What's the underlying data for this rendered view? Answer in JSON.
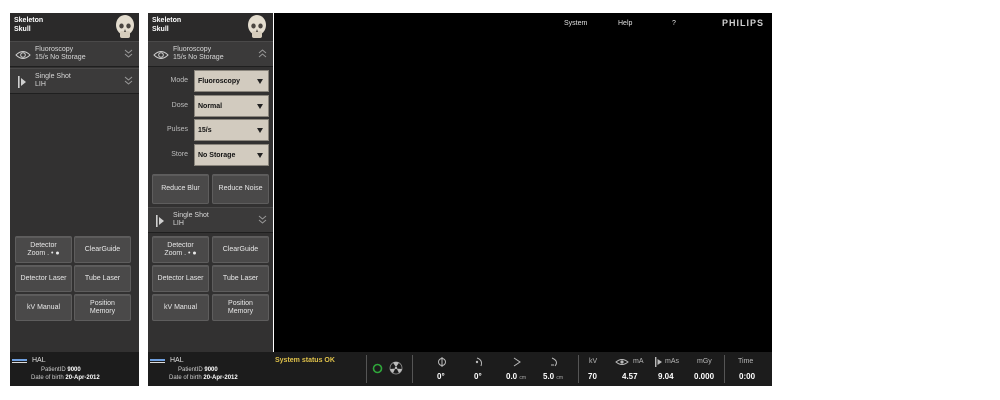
{
  "header": {
    "line1": "Skeleton",
    "line2": "Skull"
  },
  "fluoro": {
    "line1": "Fluoroscopy",
    "line2": "15/s  No Storage"
  },
  "single": {
    "line1": "Single Shot",
    "line2": "LIH"
  },
  "settings": {
    "mode_label": "Mode",
    "mode_value": "Fluoroscopy",
    "dose_label": "Dose",
    "dose_value": "Normal",
    "pulses_label": "Pulses",
    "pulses_value": "15/s",
    "store_label": "Store",
    "store_value": "No Storage"
  },
  "actions": {
    "reduce_blur": "Reduce Blur",
    "reduce_noise": "Reduce Noise"
  },
  "buttons": {
    "detector_zoom_1": "Detector",
    "detector_zoom_2": "Zoom  . • ●",
    "clearguide": "ClearGuide",
    "detector_laser": "Detector Laser",
    "tube_laser": "Tube Laser",
    "kv_manual": "kV Manual",
    "position_memory_1": "Position",
    "position_memory_2": "Memory"
  },
  "menu": {
    "system": "System",
    "help": "Help",
    "question": "?",
    "brand": "PHILIPS"
  },
  "patient": {
    "name": "HAL",
    "id_label": "PatientID",
    "id_value": "9000",
    "dob_label": "Date of birth",
    "dob_value": "20-Apr-2012"
  },
  "footer": {
    "status": "System status OK",
    "rot1": "0°",
    "rot2": "0°",
    "pos1": "0.0",
    "pos1_unit": "cm",
    "pos2": "5.0",
    "pos2_unit": "cm",
    "kv_label": "kV",
    "kv_value": "70",
    "ma_label": "mA",
    "ma_value": "4.57",
    "mas_label": "mAs",
    "mas_value": "9.04",
    "mgy_label": "mGy",
    "mgy_value": "0.000",
    "time_label": "Time",
    "time_value": "0:00"
  },
  "colors": {
    "panel": "#323131",
    "viewer": "#000000",
    "select": "#d2cbbf",
    "status": "#e0c24a",
    "ok_ring": "#2fa63a"
  }
}
